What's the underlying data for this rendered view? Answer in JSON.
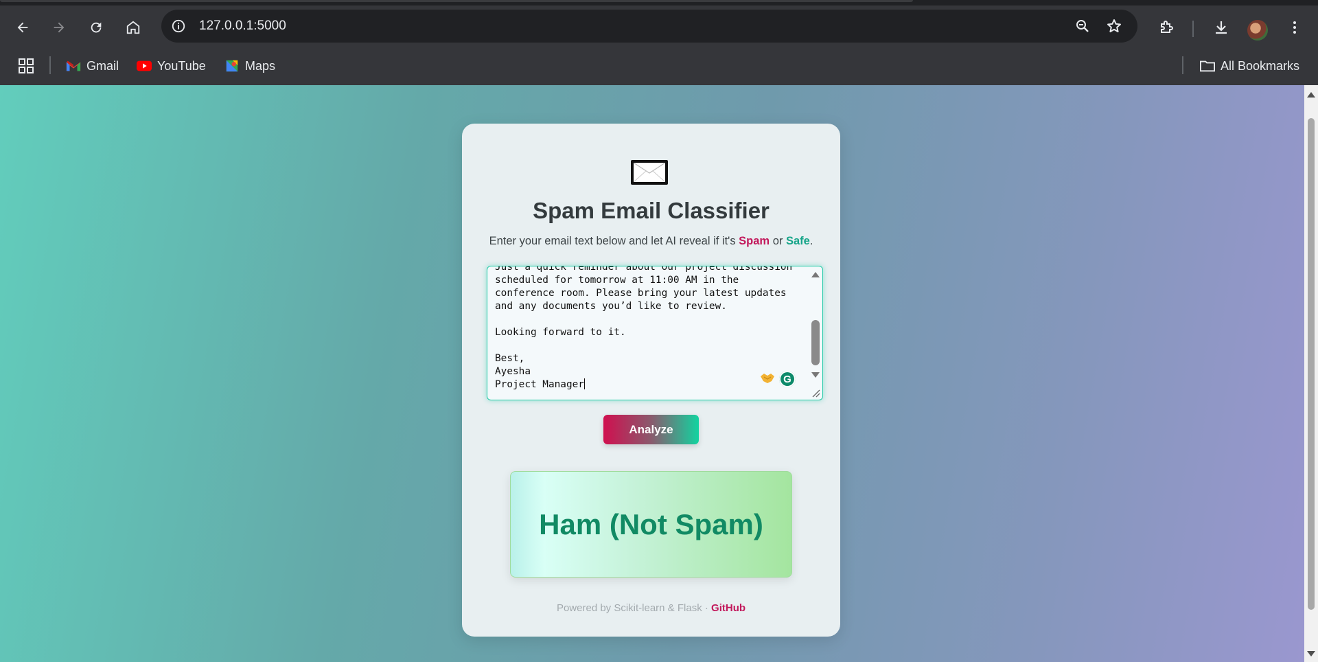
{
  "browser": {
    "url": "127.0.0.1:5000",
    "bookmarks": [
      {
        "label": "Gmail",
        "icon": "gmail-icon"
      },
      {
        "label": "YouTube",
        "icon": "youtube-icon"
      },
      {
        "label": "Maps",
        "icon": "maps-icon"
      }
    ],
    "all_bookmarks": "All Bookmarks"
  },
  "app": {
    "icon": "envelope-icon",
    "title": "Spam Email Classifier",
    "subtitle_prefix": "Enter your email text below and let AI reveal if it's ",
    "subtitle_spam": "Spam",
    "subtitle_or": " or ",
    "subtitle_safe": "Safe",
    "subtitle_end": ".",
    "email_lines": [
      "Just a quick reminder about our project discussion",
      "scheduled for tomorrow at 11:00 AM in the",
      "conference room. Please bring your latest updates",
      "and any documents you’d like to review.",
      "",
      "Looking forward to it.",
      "",
      "Best,",
      "Ayesha",
      "Project Manager"
    ],
    "analyze_label": "Analyze",
    "result": "Ham (Not Spam)",
    "footer_text": "Powered by Scikit-learn & Flask · ",
    "footer_link": "GitHub"
  },
  "colors": {
    "spam": "#c2185b",
    "safe": "#17a589",
    "result_text": "#118a64"
  }
}
